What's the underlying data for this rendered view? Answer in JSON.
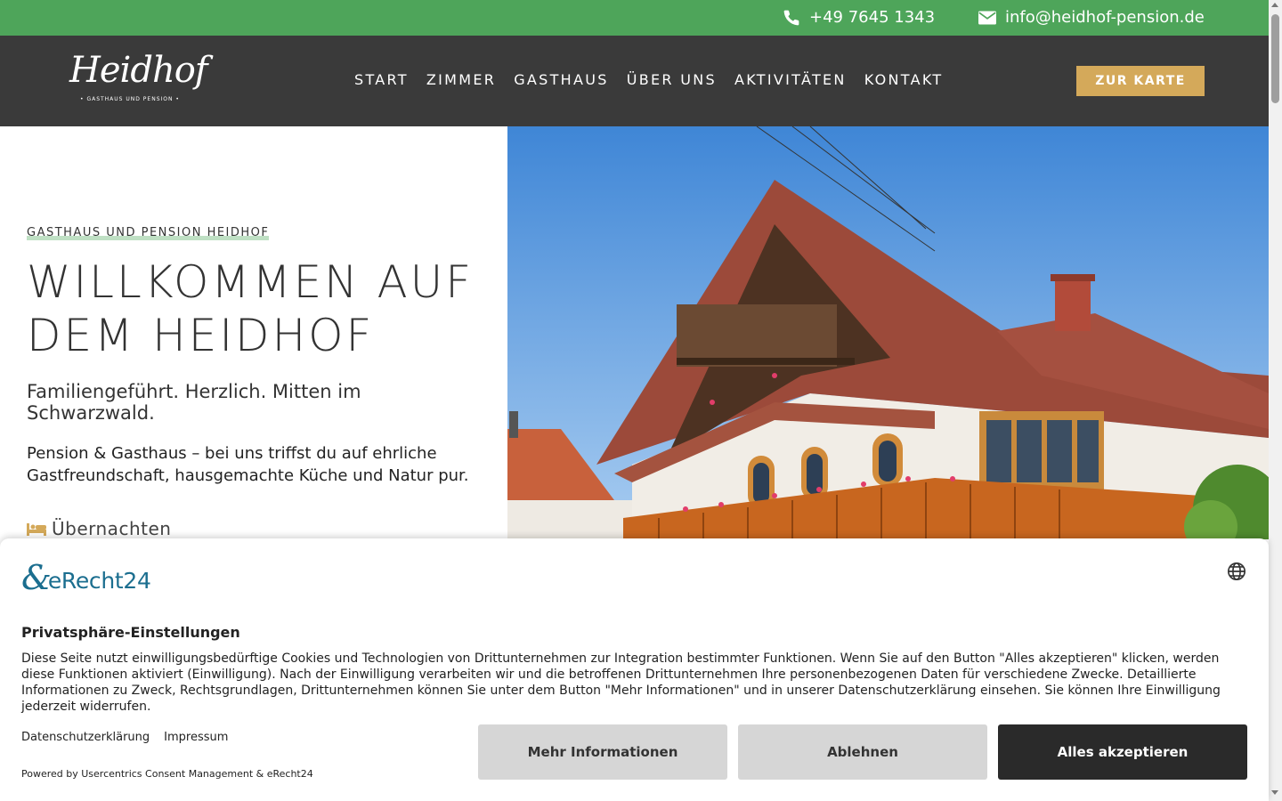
{
  "topbar": {
    "phone": "+49 7645 1343",
    "email": "info@heidhof-pension.de"
  },
  "logo": {
    "name": "Heidhof",
    "tagline": "• GASTHAUS UND PENSION •"
  },
  "nav": {
    "items": [
      "START",
      "ZIMMER",
      "GASTHAUS",
      "ÜBER UNS",
      "AKTIVITÄTEN",
      "KONTAKT"
    ],
    "cta": "ZUR KARTE"
  },
  "hero": {
    "eyebrow": "GASTHAUS UND PENSION HEIDHOF",
    "headline": "WILLKOMMEN AUF DEM HEIDHOF",
    "subheadline": "Familiengeführt. Herzlich. Mitten im Schwarzwald.",
    "lead": "Pension & Gasthaus – bei uns triffst du auf ehrliche Gastfreundschaft, hausgemachte Küche und Natur pur.",
    "stay_link": "Übernachten"
  },
  "consent": {
    "brand_mark": "&",
    "brand_word": "eRecht24",
    "title": "Privatsphäre-Einstellungen",
    "text": "Diese Seite nutzt einwilligungsbedürftige Cookies und Technologien von Drittunternehmen zur Integration bestimmter Funktionen. Wenn Sie auf den Button \"Alles akzeptieren\" klicken, werden diese Funktionen aktiviert (Einwilligung). Nach der Einwilligung verarbeiten wir und die betroffenen Drittunternehmen Ihre personenbezogenen Daten für verschiedene Zwecke. Detaillierte Informationen zu Zweck, Rechtsgrundlagen, Drittunternehmen können Sie unter dem Button \"Mehr Informationen\" und in unserer Datenschutzerklärung einsehen. Sie können Ihre Einwilligung jederzeit widerrufen.",
    "link_privacy": "Datenschutzerklärung",
    "link_imprint": "Impressum",
    "powered": "Powered by Usercentrics Consent Management & eRecht24",
    "btn_more": "Mehr Informationen",
    "btn_deny": "Ablehnen",
    "btn_accept": "Alles akzeptieren"
  },
  "colors": {
    "topbar": "#4ea55a",
    "navbar": "#3a3a3a",
    "cta": "#d4a95a",
    "brand": "#1b6e8f"
  },
  "icons": {
    "phone": "phone-icon",
    "email": "envelope-icon",
    "bed": "bed-icon",
    "globe": "globe-icon"
  }
}
